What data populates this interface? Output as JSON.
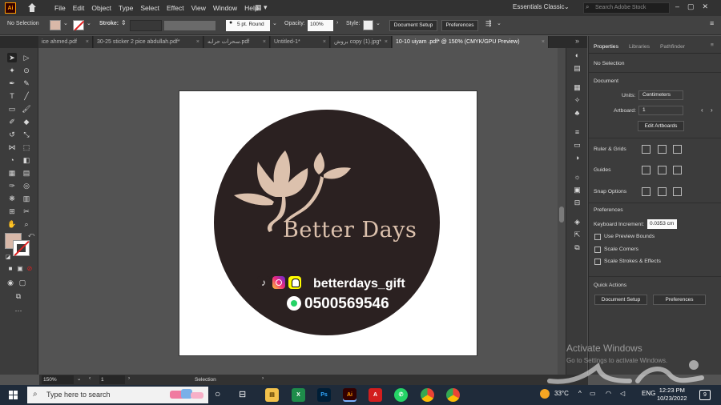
{
  "app": {
    "name": "Adobe Illustrator",
    "logo_text": "Ai"
  },
  "menu": {
    "items": [
      "File",
      "Edit",
      "Object",
      "Type",
      "Select",
      "Effect",
      "View",
      "Window",
      "Help"
    ]
  },
  "workspace": "Essentials Classic",
  "search": {
    "placeholder": "Search Adobe Stock"
  },
  "control_bar": {
    "selection": "No Selection",
    "stroke_label": "Stroke:",
    "brush": "5 pt. Round",
    "opacity_label": "Opacity:",
    "opacity_value": "100%",
    "style_label": "Style:",
    "document_setup": "Document Setup",
    "preferences": "Preferences",
    "fill_color": "#d8b8a8"
  },
  "tabs": [
    {
      "label": "ice ahmed.pdf",
      "active": false
    },
    {
      "label": "30-25 sticker 2 pice abdullah.pdf*",
      "active": false
    },
    {
      "label": "سحرات حرابه.pdf",
      "active": false
    },
    {
      "label": "Untitled-1*",
      "active": false
    },
    {
      "label": "بروش copy (1).jpg*",
      "active": false
    },
    {
      "label": "10-10 uiyam .pdf* @ 150% (CMYK/GPU Preview)",
      "active": true
    }
  ],
  "artwork": {
    "brand_name": "Better Days",
    "handle": "betterdays_gift",
    "phone": "0500569546",
    "circle_color": "#2b2121",
    "accent_color": "#dcc1ad",
    "social_icons": [
      "tiktok-icon",
      "instagram-icon",
      "snapchat-icon"
    ]
  },
  "panel": {
    "tabs": [
      "Properties",
      "Libraries",
      "Pathfinder"
    ],
    "selection": "No Selection",
    "document_header": "Document",
    "units_label": "Units:",
    "units_value": "Centimeters",
    "artboard_label": "Artboard:",
    "artboard_value": "1",
    "edit_artboards": "Edit Artboards",
    "ruler_grids": "Ruler & Grids",
    "guides": "Guides",
    "snap_options": "Snap Options",
    "preferences_header": "Preferences",
    "keyboard_increment_label": "Keyboard Increment:",
    "keyboard_increment_value": "0.0353 cm",
    "use_preview_bounds": "Use Preview Bounds",
    "scale_corners": "Scale Corners",
    "scale_strokes": "Scale Strokes & Effects",
    "quick_actions": "Quick Actions",
    "document_setup": "Document Setup",
    "preferences": "Preferences"
  },
  "status_bar": {
    "zoom": "150%",
    "page": "1",
    "tool": "Selection"
  },
  "watermark": {
    "title": "Activate Windows",
    "subtitle": "Go to Settings to activate Windows."
  },
  "taskbar": {
    "search_placeholder": "Type here to search",
    "temperature": "33°C",
    "language": "ENG",
    "time": "12:23 PM",
    "date": "10/23/2022",
    "notifications": "9"
  }
}
